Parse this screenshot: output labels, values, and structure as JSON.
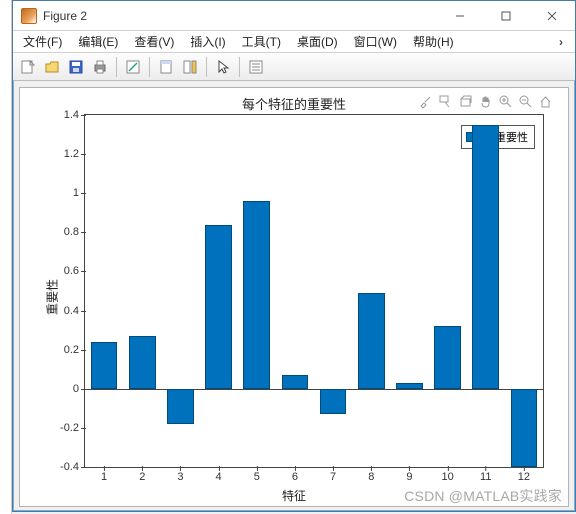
{
  "window": {
    "title": "Figure 2",
    "min": "–",
    "max": "□",
    "close": "✕"
  },
  "menu": {
    "file": "文件(F)",
    "edit": "编辑(E)",
    "view": "查看(V)",
    "insert": "插入(I)",
    "tools": "工具(T)",
    "desktop": "桌面(D)",
    "window": "窗口(W)",
    "help": "帮助(H)",
    "prompt": "›"
  },
  "chart": {
    "title": "每个特征的重要性",
    "xlabel": "特征",
    "ylabel": "重要性",
    "legend": "重要性"
  },
  "watermark": "CSDN @MATLAB实践家",
  "chart_data": {
    "type": "bar",
    "categories": [
      "1",
      "2",
      "3",
      "4",
      "5",
      "6",
      "7",
      "8",
      "9",
      "10",
      "11",
      "12"
    ],
    "values": [
      0.24,
      0.27,
      -0.18,
      0.84,
      0.96,
      0.07,
      -0.13,
      0.49,
      0.03,
      0.32,
      1.35,
      -0.4
    ],
    "title": "每个特征的重要性",
    "xlabel": "特征",
    "ylabel": "重要性",
    "ylim": [
      -0.4,
      1.4
    ],
    "yticks": [
      -0.4,
      -0.2,
      0,
      0.2,
      0.4,
      0.6,
      0.8,
      1,
      1.2,
      1.4
    ],
    "series": [
      {
        "name": "重要性"
      }
    ]
  }
}
